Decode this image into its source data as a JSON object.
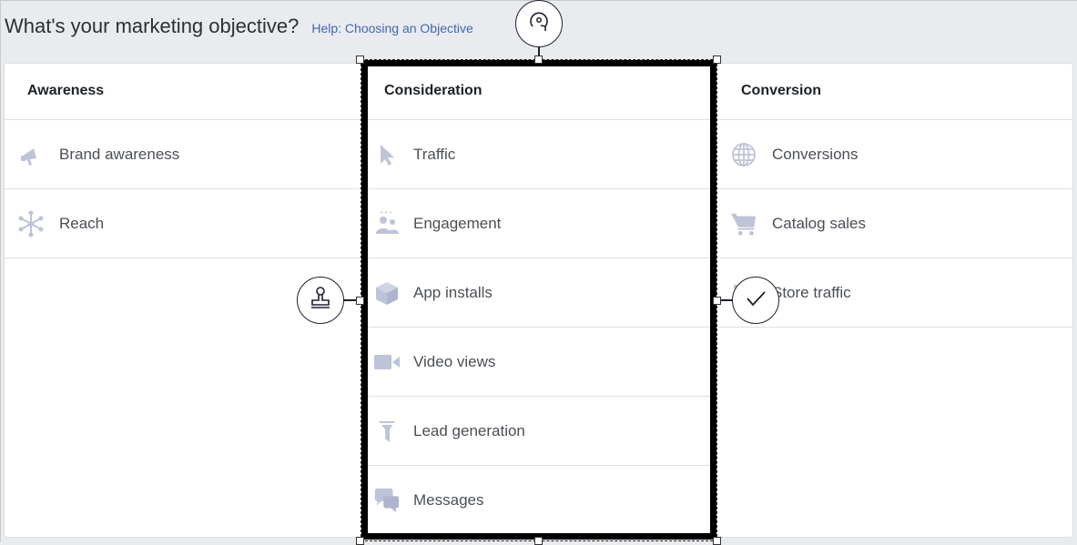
{
  "header": {
    "title": "What's your marketing objective?",
    "help_link": "Help: Choosing an Objective"
  },
  "columns": {
    "awareness": {
      "title": "Awareness",
      "items": [
        {
          "label": "Brand awareness",
          "icon": "megaphone-icon"
        },
        {
          "label": "Reach",
          "icon": "reach-icon"
        }
      ]
    },
    "consideration": {
      "title": "Consideration",
      "items": [
        {
          "label": "Traffic",
          "icon": "cursor-icon"
        },
        {
          "label": "Engagement",
          "icon": "people-icon"
        },
        {
          "label": "App installs",
          "icon": "box-icon"
        },
        {
          "label": "Video views",
          "icon": "video-camera-icon"
        },
        {
          "label": "Lead generation",
          "icon": "funnel-icon"
        },
        {
          "label": "Messages",
          "icon": "chat-bubbles-icon"
        }
      ]
    },
    "conversion": {
      "title": "Conversion",
      "items": [
        {
          "label": "Conversions",
          "icon": "globe-icon"
        },
        {
          "label": "Catalog sales",
          "icon": "cart-icon"
        },
        {
          "label": "Store traffic",
          "icon": "store-icon"
        }
      ]
    }
  },
  "colors": {
    "icon": "#bec3d8",
    "link": "#4267b2",
    "selection": "#000000"
  }
}
